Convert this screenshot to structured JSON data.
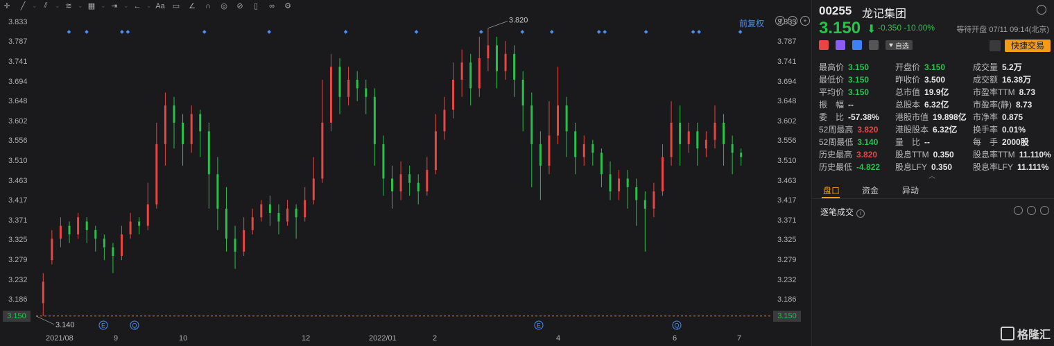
{
  "toolbar": {
    "icons": [
      "crosshair-icon",
      "trendline-icon",
      "channel-icon",
      "fibonacci-icon",
      "measure-icon",
      "range-icon",
      "arrow-icon",
      "text-icon",
      "comment-icon",
      "pen-icon",
      "magnet-icon",
      "eye-icon",
      "hide-icon",
      "trash-icon",
      "link-icon",
      "settings-icon"
    ],
    "text_tool": "Aa"
  },
  "chart_controls": {
    "fuquan_label": "前复权"
  },
  "price_axis": {
    "ticks": [
      "3.833",
      "3.787",
      "3.741",
      "3.694",
      "3.648",
      "3.602",
      "3.556",
      "3.510",
      "3.463",
      "3.417",
      "3.371",
      "3.325",
      "3.279",
      "3.232",
      "3.186",
      "3.150"
    ],
    "current_price_tag": "3.150"
  },
  "annotations": {
    "high_label": "3.820",
    "low_label": "3.140"
  },
  "event_markers": {
    "e_label": "E",
    "q_label": "Q"
  },
  "date_axis": {
    "labels": [
      "2021/08",
      "9",
      "10",
      "12",
      "2022/01",
      "2",
      "4",
      "6",
      "7"
    ]
  },
  "stock": {
    "code": "00255",
    "name": "龙记集团",
    "price": "3.150",
    "change": "-0.350",
    "change_pct": "-10.00%",
    "status": "等待开盘 07/11 09:14(北京)",
    "zixuan_label": "自选",
    "quick_trade_label": "快捷交易"
  },
  "stats": [
    {
      "k": "最高价",
      "v": "3.150",
      "c": "g"
    },
    {
      "k": "开盘价",
      "v": "3.150",
      "c": "g"
    },
    {
      "k": "成交量",
      "v": "5.2万",
      "c": ""
    },
    {
      "k": "最低价",
      "v": "3.150",
      "c": "g"
    },
    {
      "k": "昨收价",
      "v": "3.500",
      "c": ""
    },
    {
      "k": "成交额",
      "v": "16.38万",
      "c": ""
    },
    {
      "k": "平均价",
      "v": "3.150",
      "c": "g"
    },
    {
      "k": "总市值",
      "v": "19.9亿",
      "c": ""
    },
    {
      "k": "市盈率TTM",
      "v": "8.73",
      "c": ""
    },
    {
      "k": "振　幅",
      "v": "--",
      "c": ""
    },
    {
      "k": "总股本",
      "v": "6.32亿",
      "c": ""
    },
    {
      "k": "市盈率(静)",
      "v": "8.73",
      "c": ""
    },
    {
      "k": "委　比",
      "v": "-57.38%",
      "c": ""
    },
    {
      "k": "港股市值",
      "v": "19.898亿",
      "c": ""
    },
    {
      "k": "市净率",
      "v": "0.875",
      "c": ""
    },
    {
      "k": "52周最高",
      "v": "3.820",
      "c": "r"
    },
    {
      "k": "港股股本",
      "v": "6.32亿",
      "c": ""
    },
    {
      "k": "换手率",
      "v": "0.01%",
      "c": ""
    },
    {
      "k": "52周最低",
      "v": "3.140",
      "c": "g"
    },
    {
      "k": "量　比",
      "v": "--",
      "c": ""
    },
    {
      "k": "每　手",
      "v": "2000股",
      "c": ""
    },
    {
      "k": "历史最高",
      "v": "3.820",
      "c": "r"
    },
    {
      "k": "股息TTM",
      "v": "0.350",
      "c": ""
    },
    {
      "k": "股息率TTM",
      "v": "11.110%",
      "c": ""
    },
    {
      "k": "历史最低",
      "v": "-4.822",
      "c": "g"
    },
    {
      "k": "股息LFY",
      "v": "0.350",
      "c": ""
    },
    {
      "k": "股息率LFY",
      "v": "11.111%",
      "c": ""
    }
  ],
  "tabs": [
    "盘口",
    "资金",
    "异动"
  ],
  "tick_section_title": "逐笔成交",
  "logo_text": "格隆汇",
  "colors": {
    "up": "#e84545",
    "down": "#27c24c",
    "accent": "#f29b1b",
    "marker": "#4a8ff5"
  },
  "chart_data": {
    "type": "candlestick",
    "ylim": [
      3.14,
      3.85
    ],
    "high": 3.82,
    "low": 3.14,
    "last": 3.15,
    "x_labels": [
      "2021/08",
      "9",
      "10",
      "12",
      "2022/01",
      "2",
      "4",
      "6",
      "7"
    ],
    "candles": [
      [
        3.18,
        3.23,
        3.15,
        3.25
      ],
      [
        3.28,
        3.33,
        3.27,
        3.35
      ],
      [
        3.33,
        3.36,
        3.31,
        3.38
      ],
      [
        3.36,
        3.34,
        3.32,
        3.37
      ],
      [
        3.34,
        3.38,
        3.33,
        3.39
      ],
      [
        3.37,
        3.35,
        3.32,
        3.38
      ],
      [
        3.35,
        3.33,
        3.3,
        3.36
      ],
      [
        3.33,
        3.31,
        3.28,
        3.34
      ],
      [
        3.31,
        3.29,
        3.25,
        3.32
      ],
      [
        3.29,
        3.34,
        3.28,
        3.36
      ],
      [
        3.34,
        3.37,
        3.33,
        3.39
      ],
      [
        3.37,
        3.36,
        3.34,
        3.38
      ],
      [
        3.36,
        3.41,
        3.35,
        3.46
      ],
      [
        3.41,
        3.55,
        3.4,
        3.6
      ],
      [
        3.55,
        3.64,
        3.5,
        3.67
      ],
      [
        3.64,
        3.6,
        3.54,
        3.66
      ],
      [
        3.6,
        3.55,
        3.5,
        3.62
      ],
      [
        3.55,
        3.62,
        3.53,
        3.64
      ],
      [
        3.62,
        3.58,
        3.52,
        3.63
      ],
      [
        3.58,
        3.48,
        3.4,
        3.6
      ],
      [
        3.48,
        3.4,
        3.35,
        3.52
      ],
      [
        3.4,
        3.33,
        3.3,
        3.45
      ],
      [
        3.33,
        3.3,
        3.26,
        3.36
      ],
      [
        3.3,
        3.35,
        3.29,
        3.38
      ],
      [
        3.35,
        3.38,
        3.34,
        3.4
      ],
      [
        3.38,
        3.41,
        3.37,
        3.42
      ],
      [
        3.41,
        3.39,
        3.36,
        3.43
      ],
      [
        3.39,
        3.37,
        3.34,
        3.41
      ],
      [
        3.37,
        3.4,
        3.36,
        3.42
      ],
      [
        3.4,
        3.38,
        3.33,
        3.41
      ],
      [
        3.38,
        3.42,
        3.37,
        3.45
      ],
      [
        3.42,
        3.47,
        3.41,
        3.52
      ],
      [
        3.47,
        3.6,
        3.46,
        3.7
      ],
      [
        3.6,
        3.73,
        3.58,
        3.76
      ],
      [
        3.73,
        3.66,
        3.62,
        3.75
      ],
      [
        3.66,
        3.7,
        3.64,
        3.73
      ],
      [
        3.7,
        3.68,
        3.65,
        3.72
      ],
      [
        3.68,
        3.66,
        3.62,
        3.7
      ],
      [
        3.66,
        3.55,
        3.5,
        3.68
      ],
      [
        3.55,
        3.47,
        3.43,
        3.57
      ],
      [
        3.47,
        3.44,
        3.4,
        3.5
      ],
      [
        3.44,
        3.48,
        3.42,
        3.51
      ],
      [
        3.48,
        3.46,
        3.43,
        3.5
      ],
      [
        3.46,
        3.44,
        3.41,
        3.48
      ],
      [
        3.44,
        3.49,
        3.43,
        3.52
      ],
      [
        3.49,
        3.58,
        3.48,
        3.62
      ],
      [
        3.58,
        3.63,
        3.56,
        3.66
      ],
      [
        3.63,
        3.7,
        3.61,
        3.74
      ],
      [
        3.7,
        3.74,
        3.66,
        3.77
      ],
      [
        3.74,
        3.68,
        3.64,
        3.76
      ],
      [
        3.68,
        3.75,
        3.66,
        3.8
      ],
      [
        3.75,
        3.78,
        3.72,
        3.82
      ],
      [
        3.78,
        3.72,
        3.68,
        3.8
      ],
      [
        3.72,
        3.76,
        3.7,
        3.79
      ],
      [
        3.76,
        3.7,
        3.66,
        3.78
      ],
      [
        3.7,
        3.64,
        3.58,
        3.72
      ],
      [
        3.64,
        3.55,
        3.45,
        3.67
      ],
      [
        3.55,
        3.5,
        3.42,
        3.58
      ],
      [
        3.5,
        3.57,
        3.48,
        3.65
      ],
      [
        3.57,
        3.64,
        3.55,
        3.73
      ],
      [
        3.64,
        3.58,
        3.52,
        3.66
      ],
      [
        3.58,
        3.52,
        3.48,
        3.6
      ],
      [
        3.52,
        3.55,
        3.5,
        3.57
      ],
      [
        3.55,
        3.53,
        3.5,
        3.56
      ],
      [
        3.53,
        3.48,
        3.45,
        3.54
      ],
      [
        3.48,
        3.44,
        3.42,
        3.51
      ],
      [
        3.44,
        3.47,
        3.42,
        3.49
      ],
      [
        3.47,
        3.45,
        3.4,
        3.49
      ],
      [
        3.45,
        3.42,
        3.36,
        3.47
      ],
      [
        3.42,
        3.4,
        3.3,
        3.44
      ],
      [
        3.4,
        3.44,
        3.38,
        3.46
      ],
      [
        3.44,
        3.52,
        3.43,
        3.55
      ],
      [
        3.52,
        3.6,
        3.5,
        3.65
      ],
      [
        3.6,
        3.55,
        3.5,
        3.64
      ],
      [
        3.55,
        3.58,
        3.53,
        3.6
      ],
      [
        3.58,
        3.54,
        3.5,
        3.6
      ],
      [
        3.54,
        3.56,
        3.52,
        3.58
      ],
      [
        3.56,
        3.6,
        3.54,
        3.64
      ],
      [
        3.6,
        3.55,
        3.5,
        3.62
      ],
      [
        3.55,
        3.53,
        3.48,
        3.57
      ],
      [
        3.53,
        3.52,
        3.5,
        3.54
      ]
    ]
  }
}
